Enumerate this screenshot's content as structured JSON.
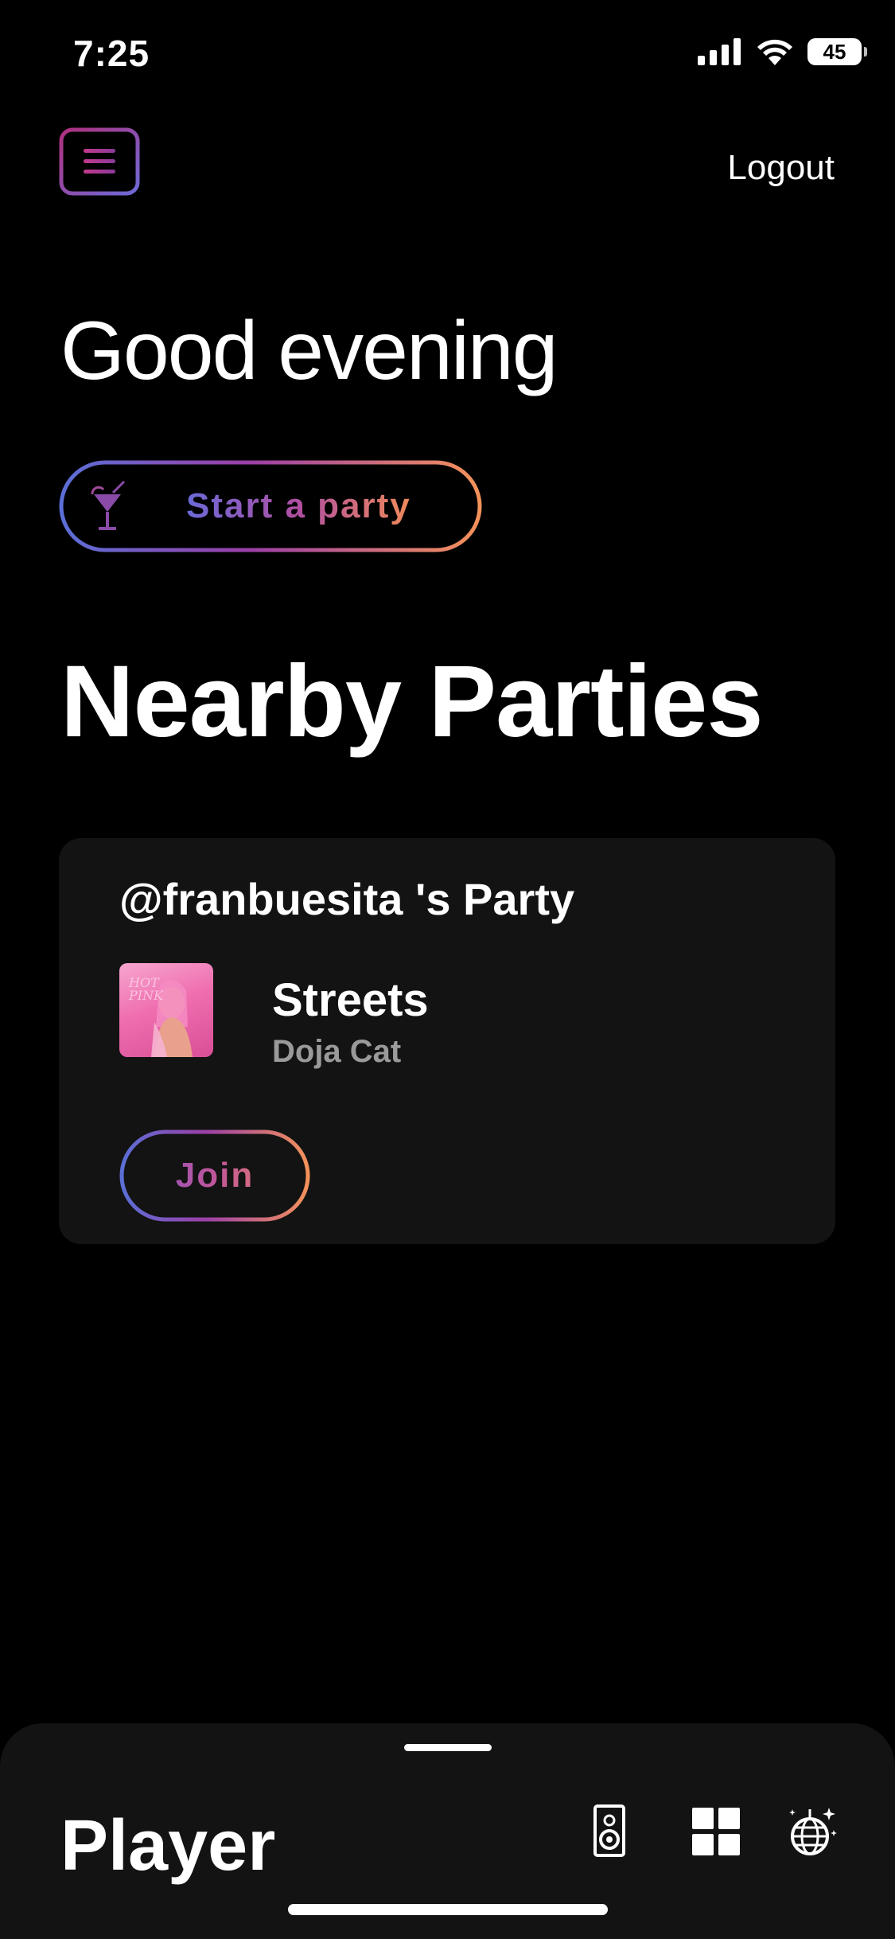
{
  "status_bar": {
    "time": "7:25",
    "battery": "45",
    "icons": [
      "signal-icon",
      "wifi-icon",
      "battery-icon"
    ]
  },
  "header": {
    "menu_icon": "menu-icon",
    "logout_label": "Logout"
  },
  "greeting": "Good evening",
  "start_party": {
    "label": "Start a party",
    "icon": "cocktail-icon"
  },
  "nearby": {
    "title": "Nearby Parties",
    "parties": [
      {
        "host": "@franbuesita 's Party",
        "track": "Streets",
        "artist": "Doja Cat",
        "join_label": "Join"
      }
    ]
  },
  "player": {
    "title": "Player",
    "icons": [
      "speaker-icon",
      "grid-icon",
      "disco-ball-icon"
    ]
  },
  "colors": {
    "background": "#000000",
    "card": "#131313",
    "gradient_start": "#6a6ad8",
    "gradient_mid": "#b04fa2",
    "gradient_end": "#f08a5a",
    "muted_text": "#9a9a9a"
  }
}
